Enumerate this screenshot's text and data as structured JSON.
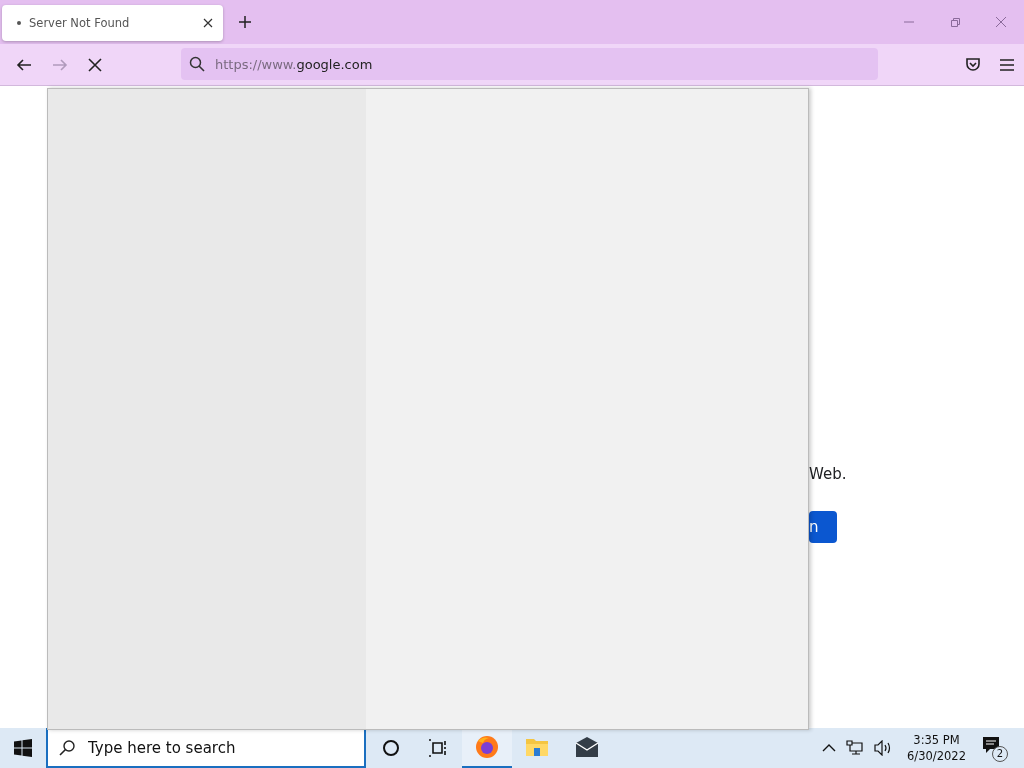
{
  "tabs": [
    {
      "title": "Server Not Found",
      "selected": true
    }
  ],
  "nav": {
    "forward_disabled": true
  },
  "address": {
    "url_prefix": "https://www.",
    "url_host": "google.com"
  },
  "page": {
    "text": "Web.",
    "button": "n"
  },
  "taskbar": {
    "search": {
      "placeholder": "Type here to search"
    },
    "apps": [
      {
        "kind": "firefox",
        "active": true
      },
      {
        "kind": "folder",
        "active": false
      },
      {
        "kind": "mail",
        "active": false
      }
    ],
    "time": "3:35 PM",
    "date": "6/30/2022",
    "notifications": "2"
  }
}
